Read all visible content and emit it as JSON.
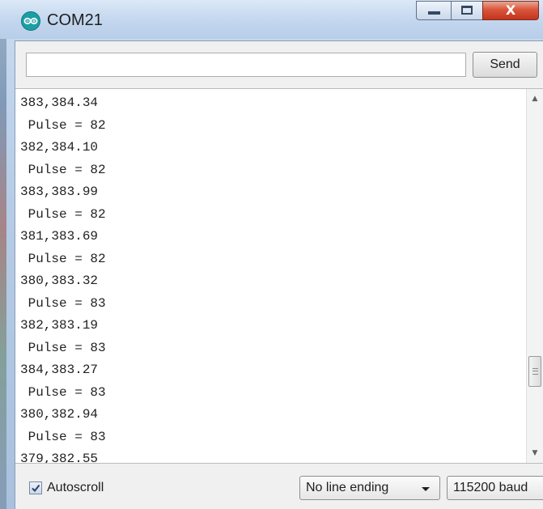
{
  "window": {
    "title": "COM21",
    "close_glyph": "X"
  },
  "send_bar": {
    "input_value": "",
    "send_label": "Send"
  },
  "serial_output": {
    "lines": [
      "383,384.34",
      " Pulse = 82",
      "382,384.10",
      " Pulse = 82",
      "383,383.99",
      " Pulse = 82",
      "381,383.69",
      " Pulse = 82",
      "380,383.32",
      " Pulse = 83",
      "382,383.19",
      " Pulse = 83",
      "384,383.27",
      " Pulse = 83",
      "380,382.94",
      " Pulse = 83",
      "379,382.55"
    ]
  },
  "footer": {
    "autoscroll_label": "Autoscroll",
    "autoscroll_checked": true,
    "line_ending": "No line ending",
    "baud_rate": "115200 baud"
  },
  "icons": {
    "app": "arduino-icon",
    "minimize": "minimize-icon",
    "maximize": "maximize-icon",
    "close": "close-icon",
    "scroll_up": "chevron-up-icon",
    "scroll_down": "chevron-down-icon",
    "dropdown": "chevron-down-icon",
    "checkbox": "checkmark-icon"
  },
  "colors": {
    "app_icon": "#1a9fa5",
    "close_button": "#c3341d",
    "title_bar": "#c3d6ee"
  }
}
